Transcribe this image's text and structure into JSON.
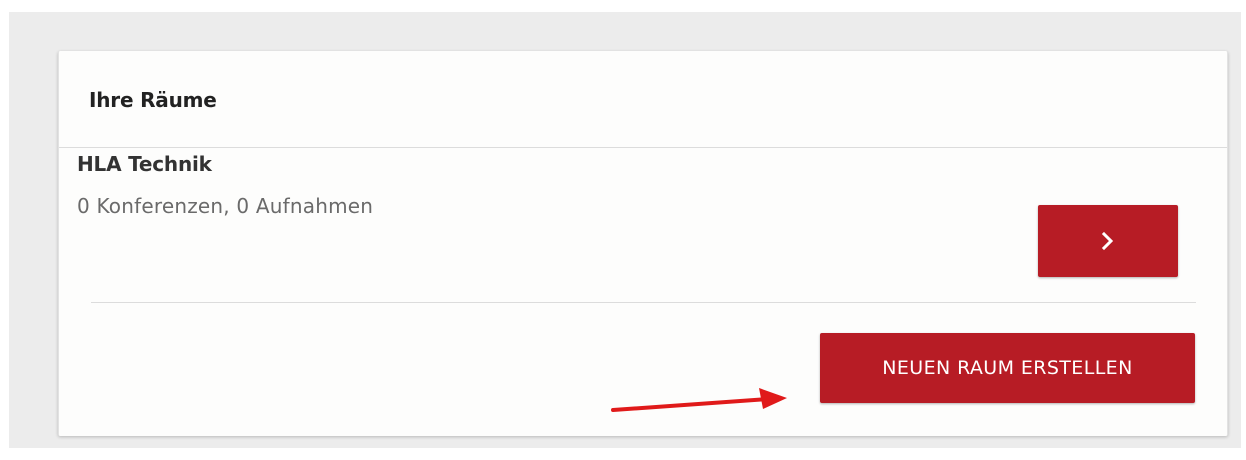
{
  "panel": {
    "title": "Ihre Räume"
  },
  "rooms": [
    {
      "name": "HLA Technik",
      "meta": "0 Konferenzen, 0 Aufnahmen",
      "open_icon": "chevron-right-icon"
    }
  ],
  "actions": {
    "create_label": "NEUEN RAUM ERSTELLEN"
  },
  "colors": {
    "accent": "#b71c25",
    "annotation_arrow": "#e01a1a",
    "background": "#ececec",
    "card": "#fdfdfc"
  }
}
